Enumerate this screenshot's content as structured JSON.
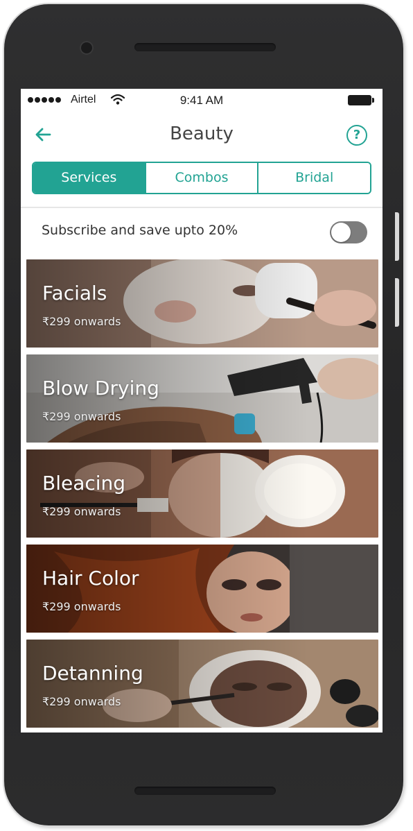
{
  "status_bar": {
    "carrier": "Airtel",
    "time": "9:41 AM"
  },
  "header": {
    "title": "Beauty",
    "help_icon_text": "?"
  },
  "tabs": [
    {
      "label": "Services",
      "active": true
    },
    {
      "label": "Combos",
      "active": false
    },
    {
      "label": "Bridal",
      "active": false
    }
  ],
  "subscribe": {
    "label": "Subscribe and save upto 20%",
    "enabled": false
  },
  "services": [
    {
      "name": "Facials",
      "price": "₹299 onwards"
    },
    {
      "name": "Blow Drying",
      "price": "₹299 onwards"
    },
    {
      "name": "Bleacing",
      "price": "₹299 onwards"
    },
    {
      "name": "Hair Color",
      "price": "₹299 onwards"
    },
    {
      "name": "Detanning",
      "price": "₹299 onwards"
    }
  ],
  "colors": {
    "accent": "#22a393",
    "toggle_off": "#7d7d7d",
    "frame": "#2b2b2c"
  },
  "icons": {
    "back": "back-arrow-icon",
    "help": "help-icon",
    "wifi": "wifi-icon",
    "battery": "battery-icon",
    "signal": "signal-dots-icon"
  }
}
